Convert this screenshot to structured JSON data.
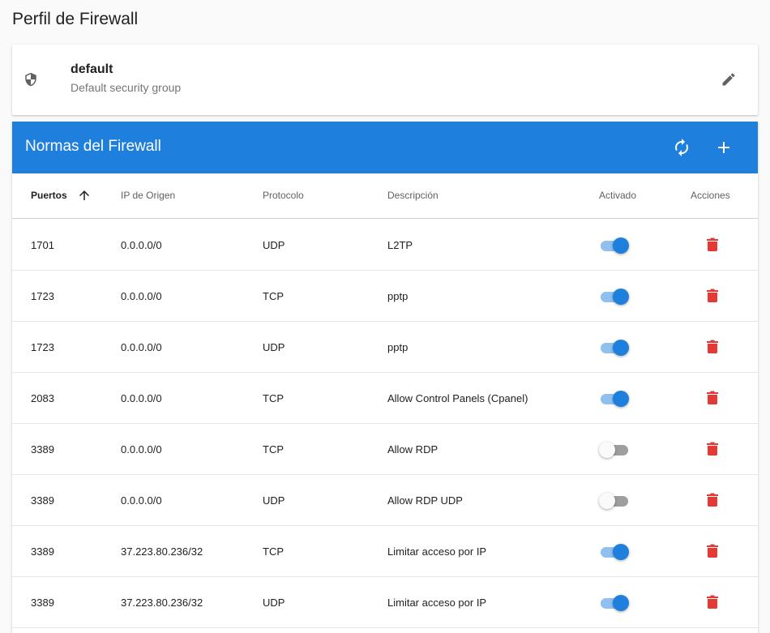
{
  "page": {
    "title": "Perfil de Firewall"
  },
  "profile": {
    "name": "default",
    "description": "Default security group",
    "icon": "shield-icon",
    "edit_icon": "pencil-icon"
  },
  "rules": {
    "title": "Normas del Firewall",
    "refresh_icon": "refresh-icon",
    "add_icon": "plus-icon",
    "columns": {
      "port": "Puertos",
      "ip": "IP de Origen",
      "protocol": "Protocolo",
      "description": "Descripción",
      "enabled": "Activado",
      "actions": "Acciones"
    },
    "sort": {
      "column": "Puertos",
      "direction": "ascending"
    },
    "rows": [
      {
        "port": "1701",
        "ip": "0.0.0.0/0",
        "protocol": "UDP",
        "description": "L2TP",
        "enabled": true
      },
      {
        "port": "1723",
        "ip": "0.0.0.0/0",
        "protocol": "TCP",
        "description": "pptp",
        "enabled": true
      },
      {
        "port": "1723",
        "ip": "0.0.0.0/0",
        "protocol": "UDP",
        "description": "pptp",
        "enabled": true
      },
      {
        "port": "2083",
        "ip": "0.0.0.0/0",
        "protocol": "TCP",
        "description": "Allow Control Panels (Cpanel)",
        "enabled": true
      },
      {
        "port": "3389",
        "ip": "0.0.0.0/0",
        "protocol": "TCP",
        "description": "Allow RDP",
        "enabled": false
      },
      {
        "port": "3389",
        "ip": "0.0.0.0/0",
        "protocol": "UDP",
        "description": "Allow RDP UDP",
        "enabled": false
      },
      {
        "port": "3389",
        "ip": "37.223.80.236/32",
        "protocol": "TCP",
        "description": "Limitar acceso por IP",
        "enabled": true
      },
      {
        "port": "3389",
        "ip": "37.223.80.236/32",
        "protocol": "UDP",
        "description": "Limitar acceso por IP",
        "enabled": true
      }
    ]
  },
  "colors": {
    "accent": "#1e7fdd",
    "toggle_track_on": "#8fc0ef",
    "delete": "#e53935"
  }
}
